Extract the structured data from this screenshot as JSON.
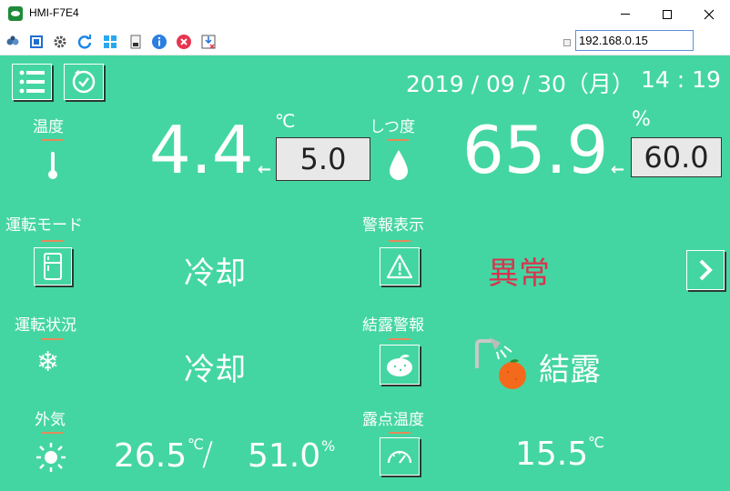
{
  "window": {
    "title": "HMI-F7E4",
    "ip_address": "192.168.0.15"
  },
  "toolbar": {
    "icons": [
      "connect-icon",
      "fullscreen-icon",
      "settings-icon",
      "refresh-icon",
      "windows-icon",
      "file-icon",
      "info-icon",
      "close-circle-icon",
      "download-icon"
    ]
  },
  "header": {
    "date": "2019 / 09 / 30（月）",
    "time": "14 : 19"
  },
  "temperature": {
    "label": "温度",
    "unit": "℃",
    "value": "4.4",
    "setpoint": "5.0"
  },
  "humidity": {
    "label": "しつ度",
    "unit": "%",
    "value": "65.9",
    "setpoint": "60.0"
  },
  "run_mode": {
    "label": "運転モード",
    "value": "冷却"
  },
  "alarm_display": {
    "label": "警報表示",
    "value": "異常",
    "value_color": "#d9344f"
  },
  "run_status": {
    "label": "運転状況",
    "value": "冷却"
  },
  "condensation_alarm": {
    "label": "結露警報",
    "value": "結露"
  },
  "outside_air": {
    "label": "外気",
    "temperature": "26.5",
    "temperature_unit": "℃",
    "separator": "/",
    "humidity": "51.0",
    "humidity_unit": "%"
  },
  "dew_point": {
    "label": "露点温度",
    "value": "15.5",
    "unit": "℃"
  },
  "colors": {
    "background": "#44d6a2",
    "accent_line": "#e58a5a",
    "alarm": "#d9344f"
  }
}
